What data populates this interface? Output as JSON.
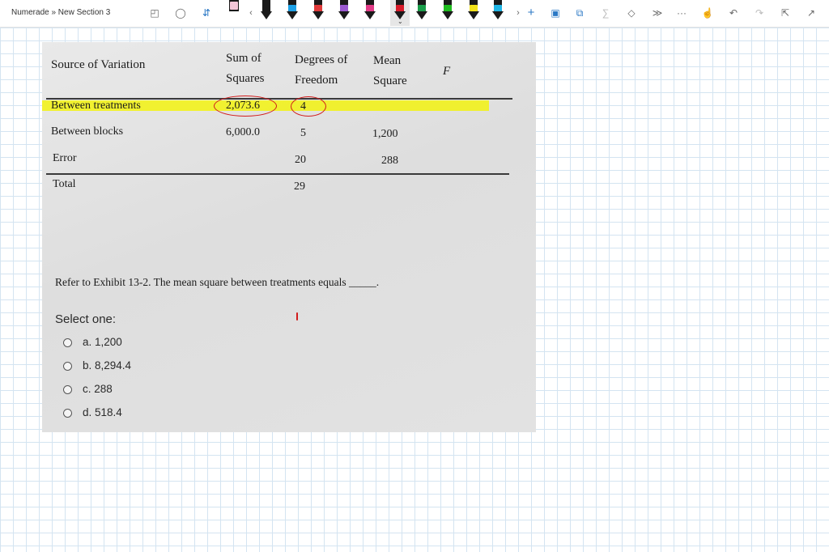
{
  "app": {
    "breadcrumb": "Numerade » New Section 3"
  },
  "toolbar": {
    "icons": [
      "lasso-select-icon",
      "shapes-icon",
      "insert-space-icon",
      "chevron-left-icon",
      "chevron-right-icon",
      "add-pen-icon",
      "highlighter-library-icon",
      "ink-to-shape-icon",
      "ink-to-math-icon",
      "eraser-icon",
      "ruler-icon",
      "more-icon",
      "touch-writing-icon",
      "undo-icon",
      "redo-icon",
      "full-page-icon",
      "collapse-icon"
    ],
    "pen_colors": [
      "#f3c6d8",
      "#1a1a1a",
      "#1ea1e6",
      "#e03a3a",
      "#e98a1f",
      "#9b59d0",
      "#e23b87",
      "#d81b2a",
      "#1a9e4a",
      "#1fbd1f",
      "#f2e21a",
      "#f2e21a",
      "#20b6e6"
    ],
    "more_symbol": "···",
    "plus_symbol": "+"
  },
  "exhibit": {
    "headers": {
      "source": "Source of Variation",
      "ss": [
        "Sum of",
        "Squares"
      ],
      "df": [
        "Degrees of",
        "Freedom"
      ],
      "ms": [
        "Mean",
        "Square"
      ],
      "f": "F"
    },
    "rows": [
      {
        "source": "Between treatments",
        "ss": "2,073.6",
        "df": "4",
        "ms": "",
        "f": ""
      },
      {
        "source": "Between blocks",
        "ss": "6,000.0",
        "df": "5",
        "ms": "1,200",
        "f": ""
      },
      {
        "source": "Error",
        "ss": "",
        "df": "20",
        "ms": "288",
        "f": ""
      },
      {
        "source": "Total",
        "ss": "",
        "df": "29",
        "ms": "",
        "f": ""
      }
    ],
    "question": "Refer to Exhibit 13-2. The mean square between treatments equals _____.",
    "select_label": "Select one:",
    "options": [
      "a. 1,200",
      "b. 8,294.4",
      "c. 288",
      "d. 518.4"
    ],
    "highlight_color": "#f2f21c",
    "annotation_color": "#d11c1c"
  }
}
